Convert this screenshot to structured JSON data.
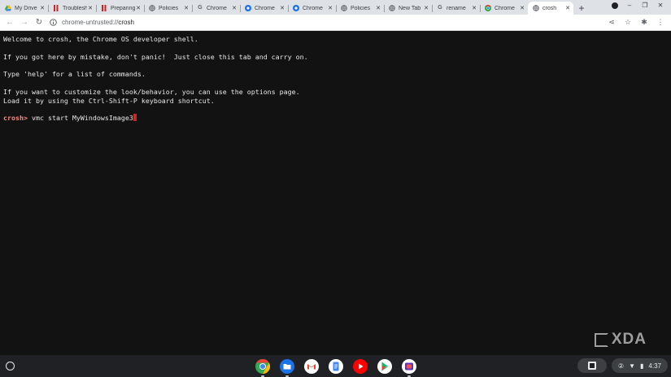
{
  "tabs": [
    {
      "label": "My Drive",
      "icon": "google-drive-icon",
      "color": "#4285f4"
    },
    {
      "label": "Troubleshoot",
      "icon": "bookmark-icon",
      "color": "#c62828"
    },
    {
      "label": "Preparing",
      "icon": "bookmark-icon",
      "color": "#c62828"
    },
    {
      "label": "Policies",
      "icon": "globe-icon",
      "color": "#5f6368"
    },
    {
      "label": "Chrome",
      "icon": "google-g-icon",
      "color": "#5f6368"
    },
    {
      "label": "Chrome",
      "icon": "chrome-enterprise-icon",
      "color": "#1a73e8"
    },
    {
      "label": "Chrome",
      "icon": "chrome-enterprise-icon",
      "color": "#1a73e8"
    },
    {
      "label": "Policies",
      "icon": "globe-icon",
      "color": "#5f6368"
    },
    {
      "label": "New Tab",
      "icon": "globe-icon",
      "color": "#5f6368"
    },
    {
      "label": "rename",
      "icon": "google-g-icon",
      "color": "#5f6368"
    },
    {
      "label": "Chrome",
      "icon": "chrome-icon",
      "color": "#34a853"
    },
    {
      "label": "crosh",
      "icon": "globe-icon",
      "color": "#5f6368",
      "active": true
    }
  ],
  "toolbar": {
    "url_prefix": "chrome-untrusted://",
    "url_path": "crosh"
  },
  "terminal": {
    "lines": [
      "Welcome to crosh, the Chrome OS developer shell.",
      "",
      "If you got here by mistake, don't panic!  Just close this tab and carry on.",
      "",
      "Type 'help' for a list of commands.",
      "",
      "If you want to customize the look/behavior, you can use the options page.",
      "Load it by using the Ctrl-Shift-P keyboard shortcut.",
      ""
    ],
    "prompt": "crosh>",
    "command": " vmc start MyWindowsImage3",
    "prompt_color": "#ff8a80",
    "cursor_color": "#c62828"
  },
  "watermark": "XDA",
  "shelf": {
    "apps": [
      {
        "name": "chrome-icon"
      },
      {
        "name": "files-icon"
      },
      {
        "name": "gmail-icon"
      },
      {
        "name": "docs-icon"
      },
      {
        "name": "youtube-icon"
      },
      {
        "name": "play-store-icon"
      },
      {
        "name": "screencast-icon"
      }
    ],
    "clock": "4:37"
  }
}
